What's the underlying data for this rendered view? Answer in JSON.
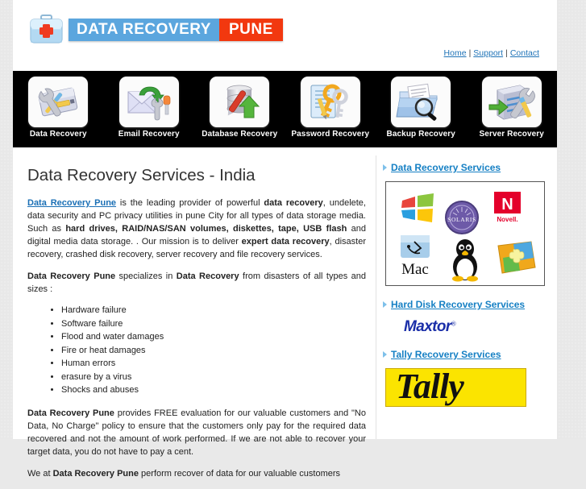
{
  "brand": {
    "logo_icon": "first-aid-kit-icon",
    "text_primary": "DATA RECOVERY",
    "text_secondary": "PUNE",
    "color_blue": "#5ba6de",
    "color_red": "#f2380f"
  },
  "top_nav": {
    "links": [
      {
        "label": "Home",
        "name": "top-nav-home"
      },
      {
        "label": "Support",
        "name": "top-nav-support"
      },
      {
        "label": "Contact",
        "name": "top-nav-contact"
      }
    ],
    "separator": "|"
  },
  "icon_nav": {
    "background": "#000000",
    "items": [
      {
        "label": "Data Recovery",
        "icon": "hard-drive-wrench-icon"
      },
      {
        "label": "Email Recovery",
        "icon": "envelope-arrow-icon"
      },
      {
        "label": "Database Recovery",
        "icon": "database-arrow-icon"
      },
      {
        "label": "Password Recovery",
        "icon": "document-keys-icon"
      },
      {
        "label": "Backup Recovery",
        "icon": "folder-magnifier-icon"
      },
      {
        "label": "Server Recovery",
        "icon": "server-wrench-icon"
      }
    ]
  },
  "main": {
    "title": "Data Recovery Services - India",
    "paragraph1": {
      "link": "Data Recovery Pune",
      "part1": " is the leading provider of powerful ",
      "bold1": "data recovery",
      "part2": ",  undelete, data security and PC privacy utilities in pune City for all types of data storage media. Such as ",
      "bold2": "hard drives, RAID/NAS/SAN volumes, diskettes, tape, USB flash",
      "part3": " and digital media data storage. . Our mission is to deliver ",
      "bold3": "expert data recovery",
      "part4": ", disaster recovery, crashed disk recovery, server recovery and file recovery services."
    },
    "paragraph2": {
      "bold1": "Data Recovery Pune",
      "part1": " specializes in ",
      "bold2": "Data Recovery",
      "part2": " from disasters of all types and sizes :"
    },
    "reasons": [
      "Hardware failure",
      "Software failure",
      "Flood and water damages",
      "Fire or heat damages",
      "Human errors",
      "erasure by a virus",
      "Shocks and abuses"
    ],
    "paragraph3": {
      "bold1": "Data Recovery Pune",
      "part1": " provides FREE evaluation for our valuable customers and \"No Data, No Charge\" policy to ensure that the customers only pay for the required data recovered and not the amount of work performed. If we are not able to recover your target data, you do not have to pay a cent."
    },
    "paragraph4": {
      "part1": "We at ",
      "bold1": "Data Recovery Pune",
      "part2": " perform recover of data for our valuable customers"
    }
  },
  "sidebar": {
    "sections": [
      {
        "heading": "Data Recovery Services",
        "name": "sidebar-data-recovery-services"
      },
      {
        "heading": "Hard Disk Recovery Services",
        "name": "sidebar-hard-disk-recovery-services"
      },
      {
        "heading": "Tally Recovery Services",
        "name": "sidebar-tally-recovery-services"
      }
    ],
    "os_logos": [
      {
        "name": "windows-logo",
        "label": "Windows"
      },
      {
        "name": "solaris-logo",
        "label": "SOLARIS"
      },
      {
        "name": "novell-logo",
        "label": "Novell."
      },
      {
        "name": "mac-logo",
        "label": "Mac"
      },
      {
        "name": "linux-tux-logo",
        "label": "Linux"
      },
      {
        "name": "puzzle-logo",
        "label": "Puzzle"
      }
    ],
    "maxtor": {
      "label": "Maxtor",
      "trademark": "®"
    },
    "tally": {
      "label": "Tally",
      "bg": "#fbe400"
    }
  }
}
